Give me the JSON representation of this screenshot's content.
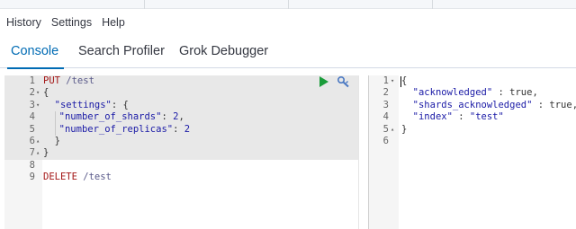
{
  "menu": {
    "items": [
      {
        "label": "History"
      },
      {
        "label": "Settings"
      },
      {
        "label": "Help"
      }
    ]
  },
  "tabs": [
    {
      "label": "Console",
      "active": true
    },
    {
      "label": "Search Profiler",
      "active": false
    },
    {
      "label": "Grok Debugger",
      "active": false
    }
  ],
  "request_editor": {
    "lines": [
      {
        "num": "1",
        "fold": "",
        "tokens": [
          {
            "t": "method",
            "v": "PUT"
          },
          {
            "t": "url",
            "v": " /test"
          }
        ]
      },
      {
        "num": "2",
        "fold": "▾",
        "tokens": [
          {
            "t": "punc",
            "v": "{"
          }
        ]
      },
      {
        "num": "3",
        "fold": "▾",
        "tokens": [
          {
            "t": "ws",
            "v": "  "
          },
          {
            "t": "key",
            "v": "\"settings\""
          },
          {
            "t": "punc",
            "v": ": {"
          }
        ]
      },
      {
        "num": "4",
        "fold": "",
        "tokens": [
          {
            "t": "ws",
            "v": "  "
          },
          {
            "t": "guide",
            "v": ""
          },
          {
            "t": "key",
            "v": "\"number_of_shards\""
          },
          {
            "t": "punc",
            "v": ": "
          },
          {
            "t": "num",
            "v": "2"
          },
          {
            "t": "punc",
            "v": ","
          }
        ]
      },
      {
        "num": "5",
        "fold": "",
        "tokens": [
          {
            "t": "ws",
            "v": "  "
          },
          {
            "t": "guide",
            "v": ""
          },
          {
            "t": "key",
            "v": "\"number_of_replicas\""
          },
          {
            "t": "punc",
            "v": ": "
          },
          {
            "t": "num",
            "v": "2"
          }
        ]
      },
      {
        "num": "6",
        "fold": "▴",
        "tokens": [
          {
            "t": "ws",
            "v": "  "
          },
          {
            "t": "punc",
            "v": "}"
          }
        ]
      },
      {
        "num": "7",
        "fold": "▴",
        "tokens": [
          {
            "t": "punc",
            "v": "}"
          }
        ]
      },
      {
        "num": "8",
        "fold": "",
        "tokens": []
      },
      {
        "num": "9",
        "fold": "",
        "tokens": [
          {
            "t": "method",
            "v": "DELETE"
          },
          {
            "t": "url",
            "v": " /test"
          }
        ]
      }
    ],
    "highlighted_rows": 7
  },
  "response_editor": {
    "lines": [
      {
        "num": "1",
        "fold": "▾",
        "tokens": [
          {
            "t": "punc",
            "v": "{"
          }
        ]
      },
      {
        "num": "2",
        "fold": "",
        "tokens": [
          {
            "t": "ws",
            "v": "  "
          },
          {
            "t": "str",
            "v": "\"acknowledged\""
          },
          {
            "t": "punc",
            "v": " : "
          },
          {
            "t": "bool",
            "v": "true"
          },
          {
            "t": "punc",
            "v": ","
          }
        ]
      },
      {
        "num": "3",
        "fold": "",
        "tokens": [
          {
            "t": "ws",
            "v": "  "
          },
          {
            "t": "str",
            "v": "\"shards_acknowledged\""
          },
          {
            "t": "punc",
            "v": " : "
          },
          {
            "t": "bool",
            "v": "true"
          },
          {
            "t": "punc",
            "v": ","
          }
        ]
      },
      {
        "num": "4",
        "fold": "",
        "tokens": [
          {
            "t": "ws",
            "v": "  "
          },
          {
            "t": "str",
            "v": "\"index\""
          },
          {
            "t": "punc",
            "v": " : "
          },
          {
            "t": "str",
            "v": "\"test\""
          }
        ]
      },
      {
        "num": "5",
        "fold": "▴",
        "tokens": [
          {
            "t": "punc",
            "v": "}"
          }
        ]
      },
      {
        "num": "6",
        "fold": "",
        "tokens": []
      }
    ],
    "highlighted_rows": 0
  },
  "icons": {
    "run": "play-icon",
    "settings": "wrench-icon"
  },
  "colors": {
    "accent": "#006bb4",
    "run_icon": "#1a9c3a",
    "method": "#a31515"
  }
}
